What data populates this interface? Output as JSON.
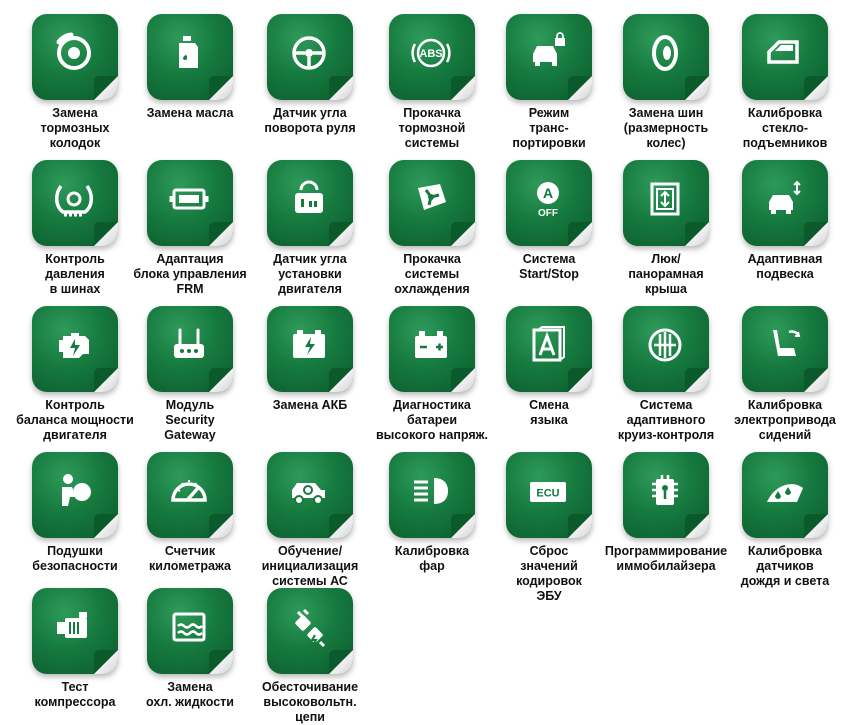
{
  "tiles": [
    {
      "label": "Замена\nтормозных\nколодок",
      "icon": "brake-disc-icon"
    },
    {
      "label": "Замена масла",
      "icon": "oil-can-icon"
    },
    {
      "label": "Датчик угла\nповорота руля",
      "icon": "steering-wheel-icon"
    },
    {
      "label": "Прокачка\nтормозной\nсистемы",
      "icon": "abs-icon"
    },
    {
      "label": "Режим\nтранс-\nпортировки",
      "icon": "car-lock-icon"
    },
    {
      "label": "Замена шин\n(размерность\nколес)",
      "icon": "tire-icon"
    },
    {
      "label": "Калибровка\nстекло-\nподъемников",
      "icon": "car-window-icon"
    },
    {
      "label": "Контроль\nдавления\nв шинах",
      "icon": "tire-pressure-icon"
    },
    {
      "label": "Адаптация\nблока управления\nFRM",
      "icon": "control-module-icon"
    },
    {
      "label": "Датчик угла\nустановки\nдвигателя",
      "icon": "camshaft-sensor-icon"
    },
    {
      "label": "Прокачка\nсистемы\nохлаждения",
      "icon": "cooling-fan-icon"
    },
    {
      "label": "Система\nStart/Stop",
      "icon": "start-stop-off-icon"
    },
    {
      "label": "Люк/\nпанорамная\nкрыша",
      "icon": "sunroof-icon"
    },
    {
      "label": "Адаптивная\nподвеска",
      "icon": "adaptive-suspension-icon"
    },
    {
      "label": "Контроль\nбаланса мощности\nдвигателя",
      "icon": "engine-power-icon"
    },
    {
      "label": "Модуль\nSecurity\nGateway",
      "icon": "gateway-router-icon"
    },
    {
      "label": "Замена АКБ",
      "icon": "battery-charge-icon"
    },
    {
      "label": "Диагностика\nбатареи\nвысокого напряж.",
      "icon": "hv-battery-icon"
    },
    {
      "label": "Смена\nязыка",
      "icon": "language-letter-icon"
    },
    {
      "label": "Система\nадаптивного\nкруиз-контроля",
      "icon": "cruise-control-icon"
    },
    {
      "label": "Калибровка\nэлектропривода\nсидений",
      "icon": "power-seat-icon"
    },
    {
      "label": "Подушки\nбезопасности",
      "icon": "airbag-icon"
    },
    {
      "label": "Счетчик\nкилометража",
      "icon": "odometer-icon"
    },
    {
      "label": "Обучение/\nинициализация\nсистемы АС",
      "icon": "car-ac-icon"
    },
    {
      "label": "Калибровка\nфар",
      "icon": "headlight-icon"
    },
    {
      "label": "Сброс\nзначений\nкодировок\nЭБУ",
      "icon": "ecu-icon"
    },
    {
      "label": "Программирование\nиммобилайзера",
      "icon": "immobilizer-chip-icon"
    },
    {
      "label": "Калибровка\nдатчиков\nдождя и света",
      "icon": "rain-light-sensor-icon"
    },
    {
      "label": "Тест\nкомпрессора",
      "icon": "compressor-icon"
    },
    {
      "label": "Замена\nохл. жидкости",
      "icon": "coolant-icon"
    },
    {
      "label": "Обесточивание\nвысоковольтн.\nцепи",
      "icon": "hv-disconnect-plug-icon"
    }
  ],
  "ecu_badge": "ECU",
  "abs_badge": "ABS",
  "off_badge": "OFF",
  "a_badge": "A",
  "colors": {
    "tile": "#167a3f",
    "tile_dark": "#0b5a2b",
    "label": "#111111"
  }
}
